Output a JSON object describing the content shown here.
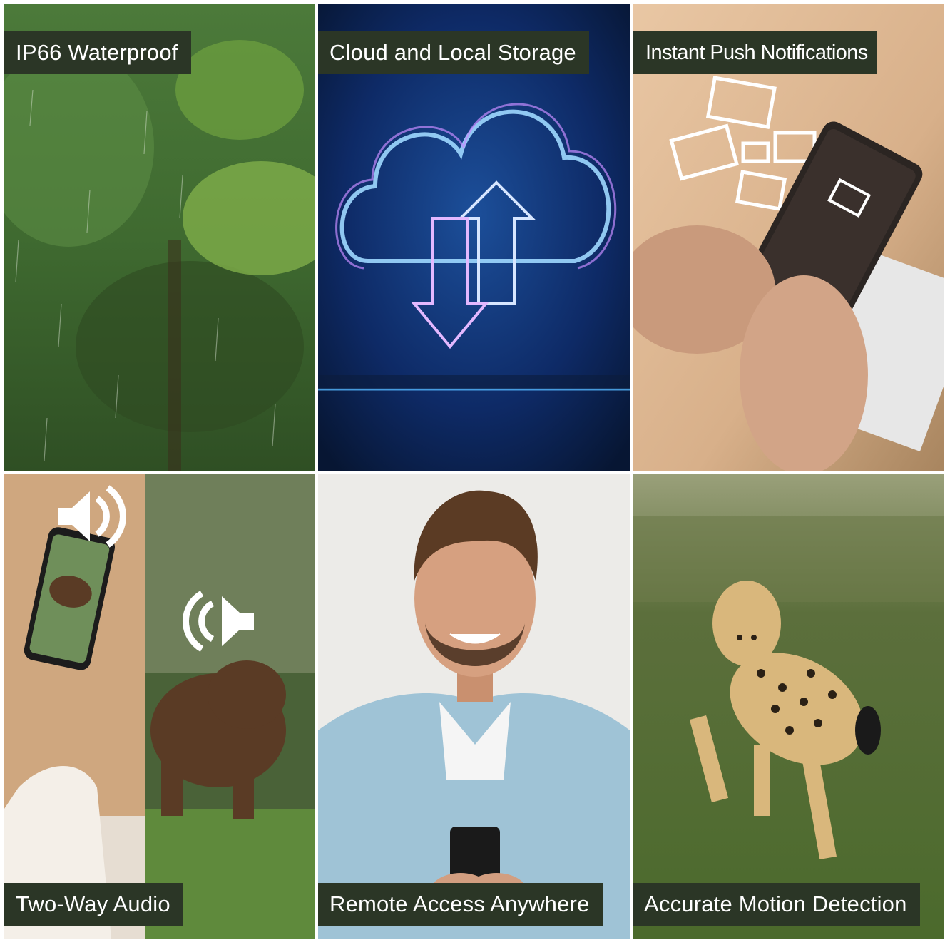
{
  "tiles": [
    {
      "label": "IP66 Waterproof",
      "scene": "rain on green tree foliage"
    },
    {
      "label": "Cloud and Local Storage",
      "scene": "glowing cloud with up and down arrows"
    },
    {
      "label": "Instant Push Notifications",
      "scene": "hands holding smartphone with envelope icons"
    },
    {
      "label": "Two-Way Audio",
      "scene": "phone showing bear on screen with speaker icons"
    },
    {
      "label": "Remote Access Anywhere",
      "scene": "smiling man looking at smartphone"
    },
    {
      "label": "Accurate Motion Detection",
      "scene": "cheetah running on grass"
    }
  ],
  "colors": {
    "label_bg": "#2b3626",
    "label_text": "#ffffff",
    "divider": "#ffffff"
  }
}
